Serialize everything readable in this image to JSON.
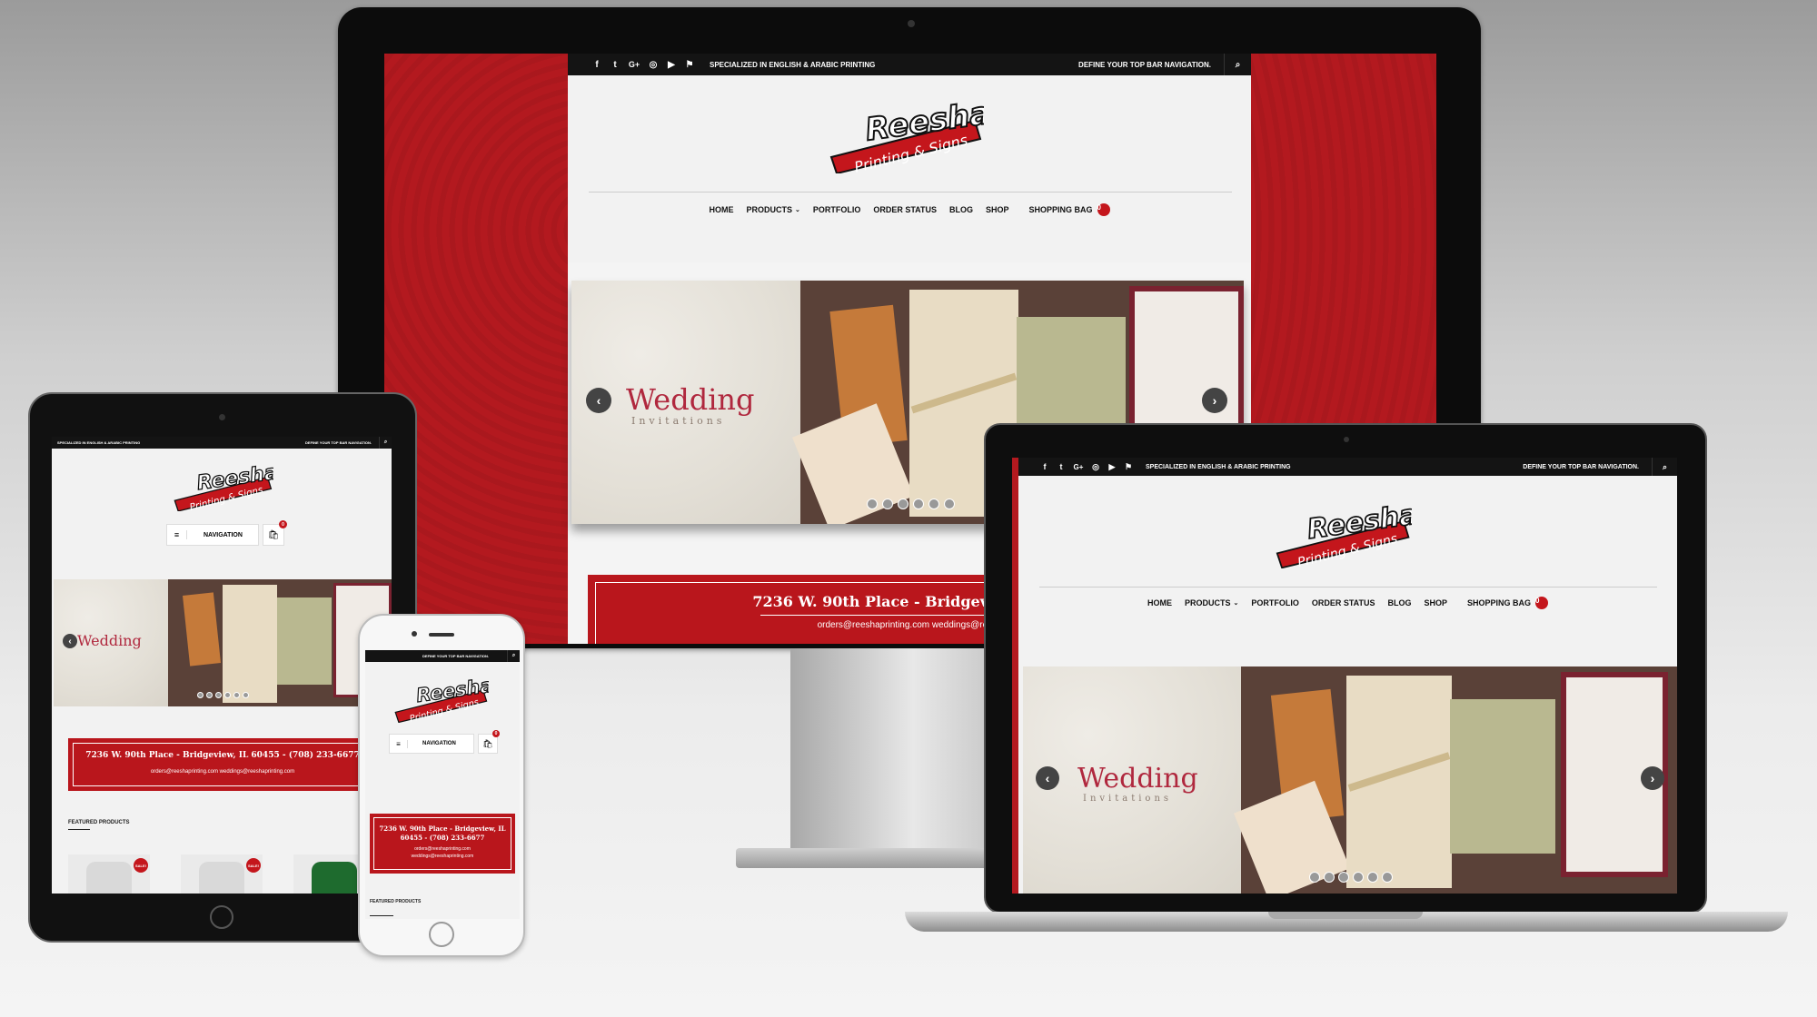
{
  "topbar": {
    "tagline": "SPECIALIZED IN ENGLISH & ARABIC PRINTING",
    "nav_note": "DEFINE YOUR TOP BAR NAVIGATION.",
    "social_icons": [
      "facebook-icon",
      "twitter-icon",
      "google-plus-icon",
      "instagram-icon",
      "youtube-icon",
      "foursquare-icon"
    ]
  },
  "logo": {
    "line1": "Reesha",
    "line2": "Printing & Signs"
  },
  "nav": {
    "home": "HOME",
    "products": "PRODUCTS",
    "portfolio": "PORTFOLIO",
    "order_status": "ORDER STATUS",
    "blog": "BLOG",
    "shop": "SHOP",
    "shopping_bag": "SHOPPING BAG",
    "bag_count": "0",
    "mobile_nav": "NAVIGATION"
  },
  "slider": {
    "title": "Wedding",
    "subtitle": "Invitations",
    "dot_count": 6
  },
  "contact": {
    "address": "7236 W. 90th Place - Bridgeview, IL 60455 - (708) 233-6677",
    "address_crop_desktop": "7236 W. 90th Place - Bridgeview, IL 604",
    "address_crop_tablet": "7236 W. 90th Place - Bridgeview, IL 60455 - (708) 233-6677",
    "address_phone_l1": "7236 W. 90th Place - Bridgeview, IL",
    "address_phone_l2": "60455 - (708) 233-6677",
    "emails": "orders@reeshaprinting.com weddings@reeshaprinting.com",
    "emails_crop_desktop": "orders@reeshaprinting.com weddings@reeshap",
    "email1": "orders@reeshaprinting.com",
    "email2": "weddings@reeshaprinting.com"
  },
  "featured": {
    "title": "FEATURED PRODUCTS",
    "sale_badge": "SALE!"
  },
  "colors": {
    "brand_red": "#b9161c",
    "topbar": "#141414",
    "page_bg": "#f2f2f2"
  }
}
